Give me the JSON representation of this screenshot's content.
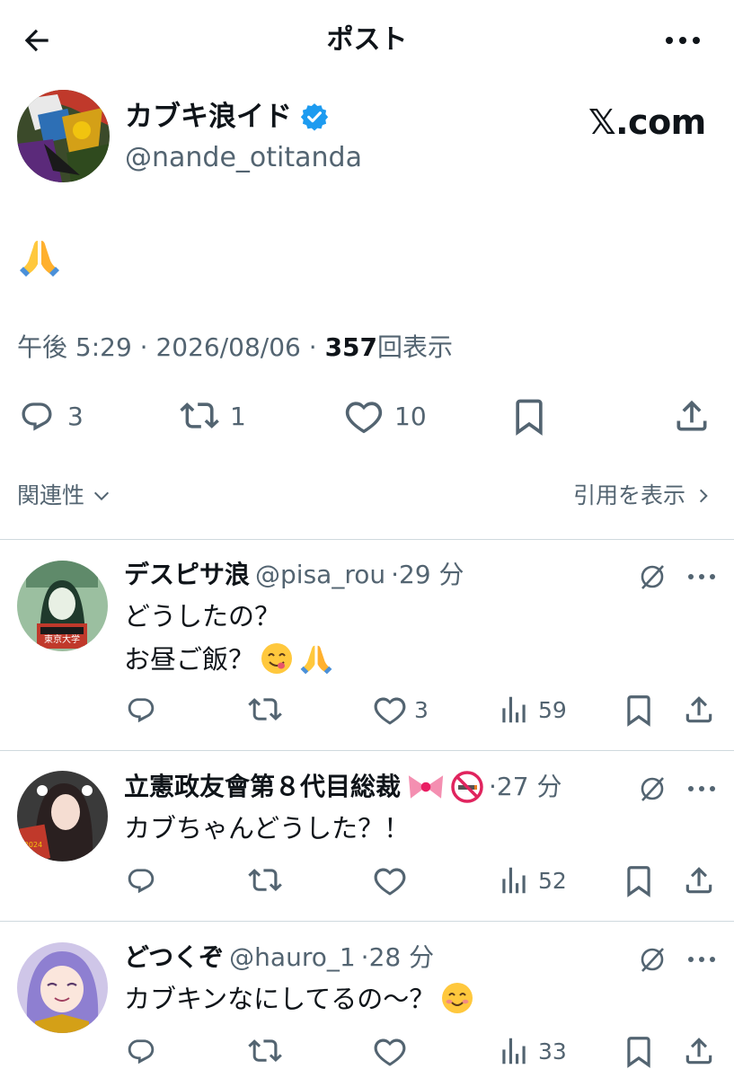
{
  "header": {
    "title": "ポスト"
  },
  "post": {
    "author_name": "カブキ浪イド",
    "author_handle": "@nande_otitanda",
    "source_label": "𝕏.com",
    "body_emoji": "folded-hands",
    "time": "午後 5:29",
    "date": "2026/08/06",
    "separator": " · ",
    "views_count": "357",
    "views_label": "回表示",
    "reply_count": "3",
    "repost_count": "1",
    "like_count": "10"
  },
  "filter": {
    "label": "関連性",
    "quotes_label": "引用を表示"
  },
  "replies": [
    {
      "name": "デスピサ浪",
      "handle": "@pisa_rou",
      "time": "·29 分",
      "line1": "どうしたの？",
      "line2": "お昼ご飯？",
      "like_count": "3",
      "view_count": "59"
    },
    {
      "name": "立憲政友會第８代目総裁",
      "handle": "",
      "time": "·27 分",
      "line1": "カブちゃんどうした？！",
      "like_count": "",
      "view_count": "52"
    },
    {
      "name": "どつくぞ",
      "handle": "@hauro_1",
      "time": "·28 分",
      "line1": "カブキンなにしてるの〜？",
      "like_count": "",
      "view_count": "33"
    }
  ],
  "colors": {
    "text": "#0f1419",
    "muted": "#536471",
    "divider": "#cfd9de",
    "verified": "#1d9bf0"
  }
}
